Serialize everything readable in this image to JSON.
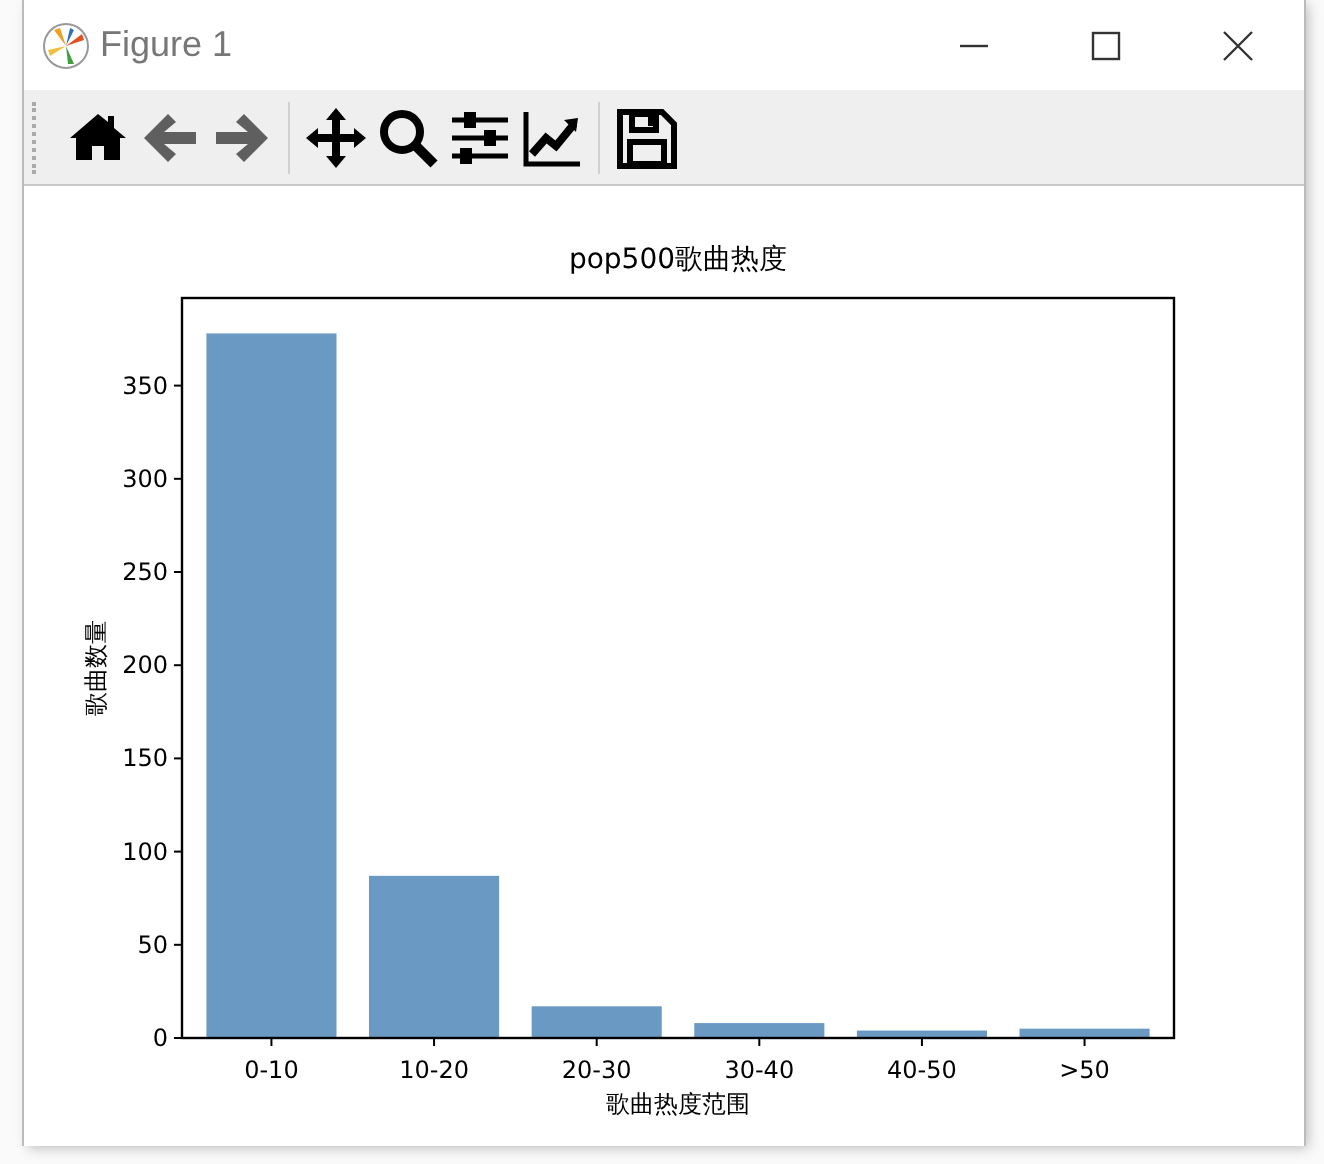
{
  "window": {
    "title": "Figure 1",
    "controls": [
      {
        "kind": "minimize"
      },
      {
        "kind": "maximize"
      },
      {
        "kind": "close"
      }
    ]
  },
  "toolbar": [
    {
      "kind": "home",
      "disabled": false
    },
    {
      "kind": "back",
      "disabled": true
    },
    {
      "kind": "forward",
      "disabled": true
    },
    {
      "kind": "separator"
    },
    {
      "kind": "pan",
      "disabled": false
    },
    {
      "kind": "zoom",
      "disabled": false
    },
    {
      "kind": "configure",
      "disabled": false
    },
    {
      "kind": "edit",
      "disabled": false
    },
    {
      "kind": "separator"
    },
    {
      "kind": "save",
      "disabled": false
    }
  ],
  "chart_data": {
    "type": "bar",
    "title": "pop500歌曲热度",
    "xlabel": "歌曲热度范围",
    "ylabel": "歌曲数量",
    "categories": [
      "0-10",
      "10-20",
      "20-30",
      "30-40",
      "40-50",
      ">50"
    ],
    "series": [
      {
        "color": "#6a9ac4",
        "values": [
          378,
          87,
          17,
          8,
          4,
          5
        ]
      }
    ],
    "ylim": [
      0,
      397
    ],
    "yticks": [
      0,
      50,
      100,
      150,
      200,
      250,
      300,
      350
    ]
  }
}
